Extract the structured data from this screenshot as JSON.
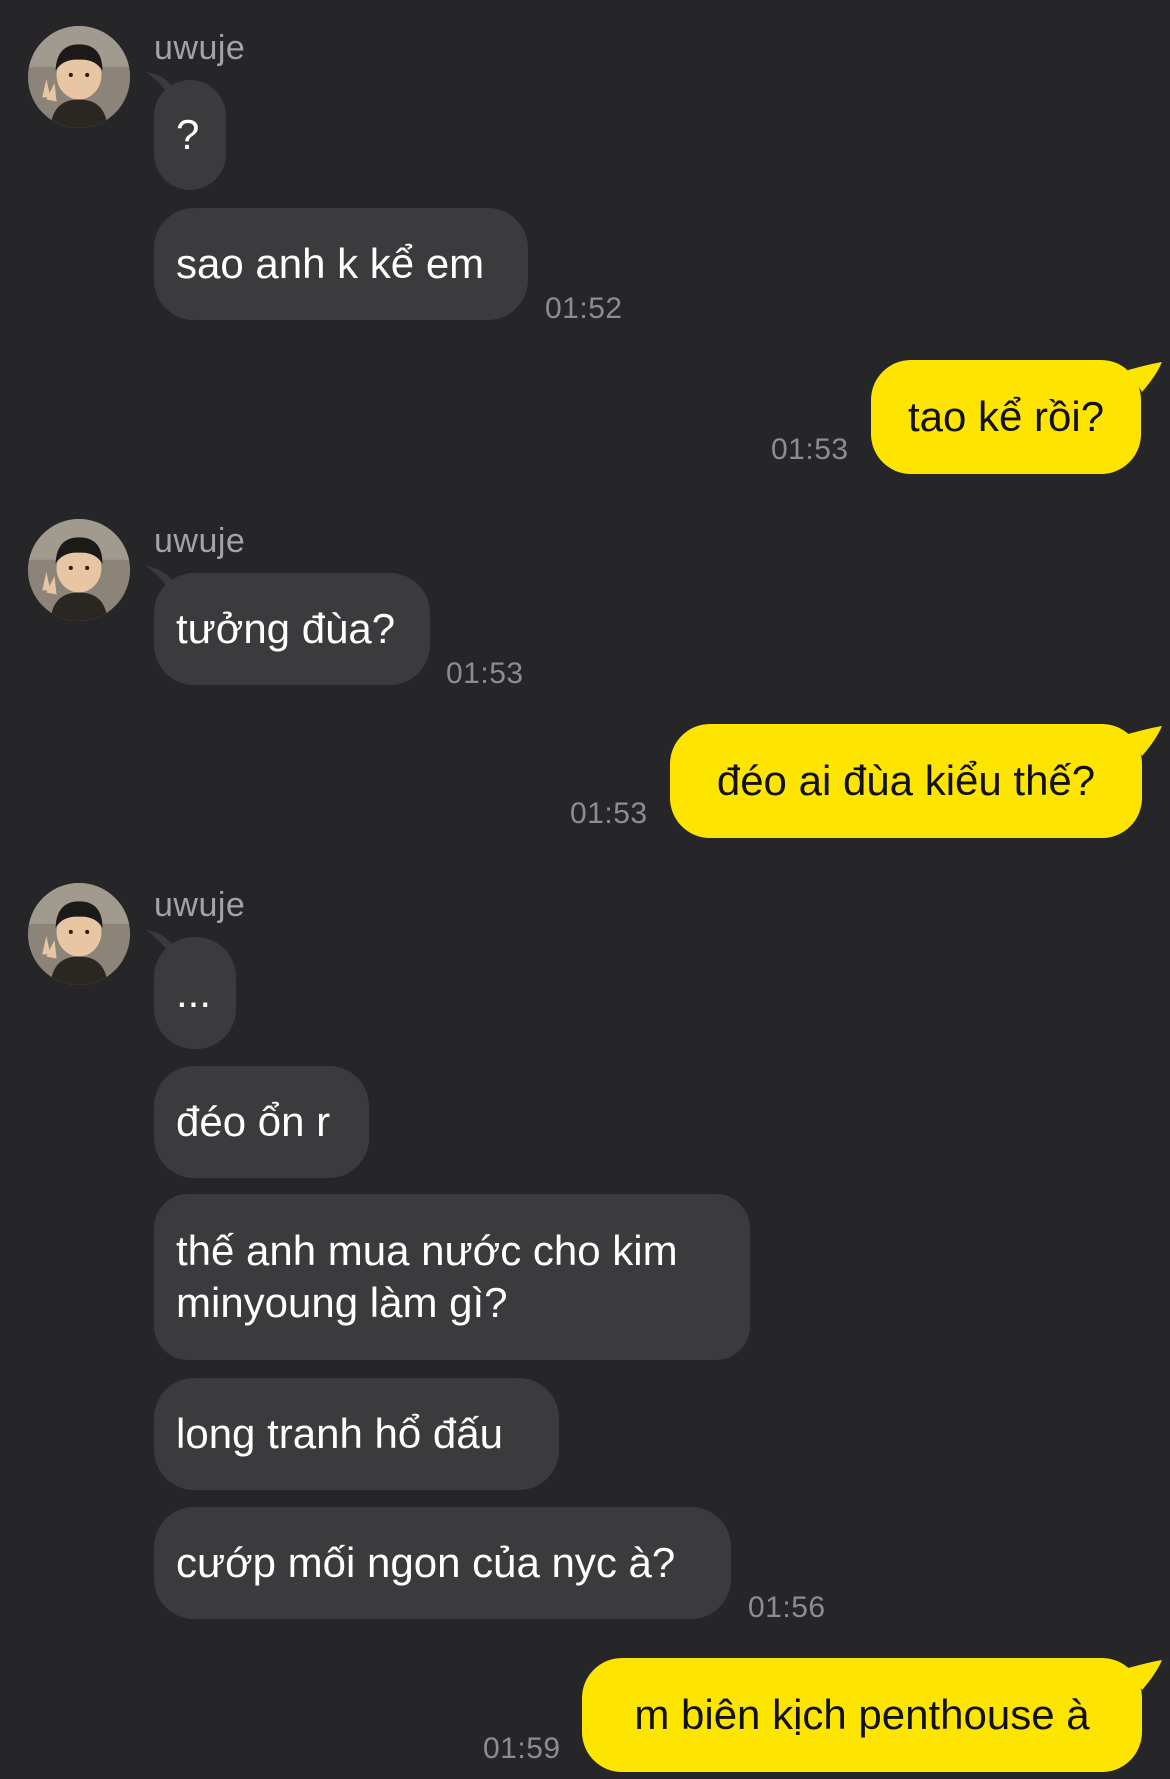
{
  "chat": {
    "contact_name": "uwuje",
    "colors": {
      "background": "#262628",
      "incoming_bubble": "#3b3b3e",
      "outgoing_bubble": "#fee500",
      "timestamp": "#8d8d90"
    },
    "messages": [
      {
        "direction": "incoming",
        "sender": "uwuje",
        "text": "?"
      },
      {
        "direction": "incoming",
        "text": "sao anh k kể em",
        "time": "01:52"
      },
      {
        "direction": "outgoing",
        "text": "tao kể rồi?",
        "time": "01:53"
      },
      {
        "direction": "incoming",
        "sender": "uwuje",
        "text": "tưởng đùa?",
        "time": "01:53"
      },
      {
        "direction": "outgoing",
        "text": "đéo ai đùa kiểu thế?",
        "time": "01:53"
      },
      {
        "direction": "incoming",
        "sender": "uwuje",
        "text": "..."
      },
      {
        "direction": "incoming",
        "text": "đéo ổn r"
      },
      {
        "direction": "incoming",
        "text_lines": [
          "thế anh mua nước cho kim",
          "minyoung làm gì?"
        ]
      },
      {
        "direction": "incoming",
        "text": "long tranh hổ đấu"
      },
      {
        "direction": "incoming",
        "text": "cướp mối ngon của nyc à?",
        "time": "01:56"
      },
      {
        "direction": "outgoing",
        "text": "m biên kịch penthouse à",
        "time": "01:59"
      }
    ]
  }
}
